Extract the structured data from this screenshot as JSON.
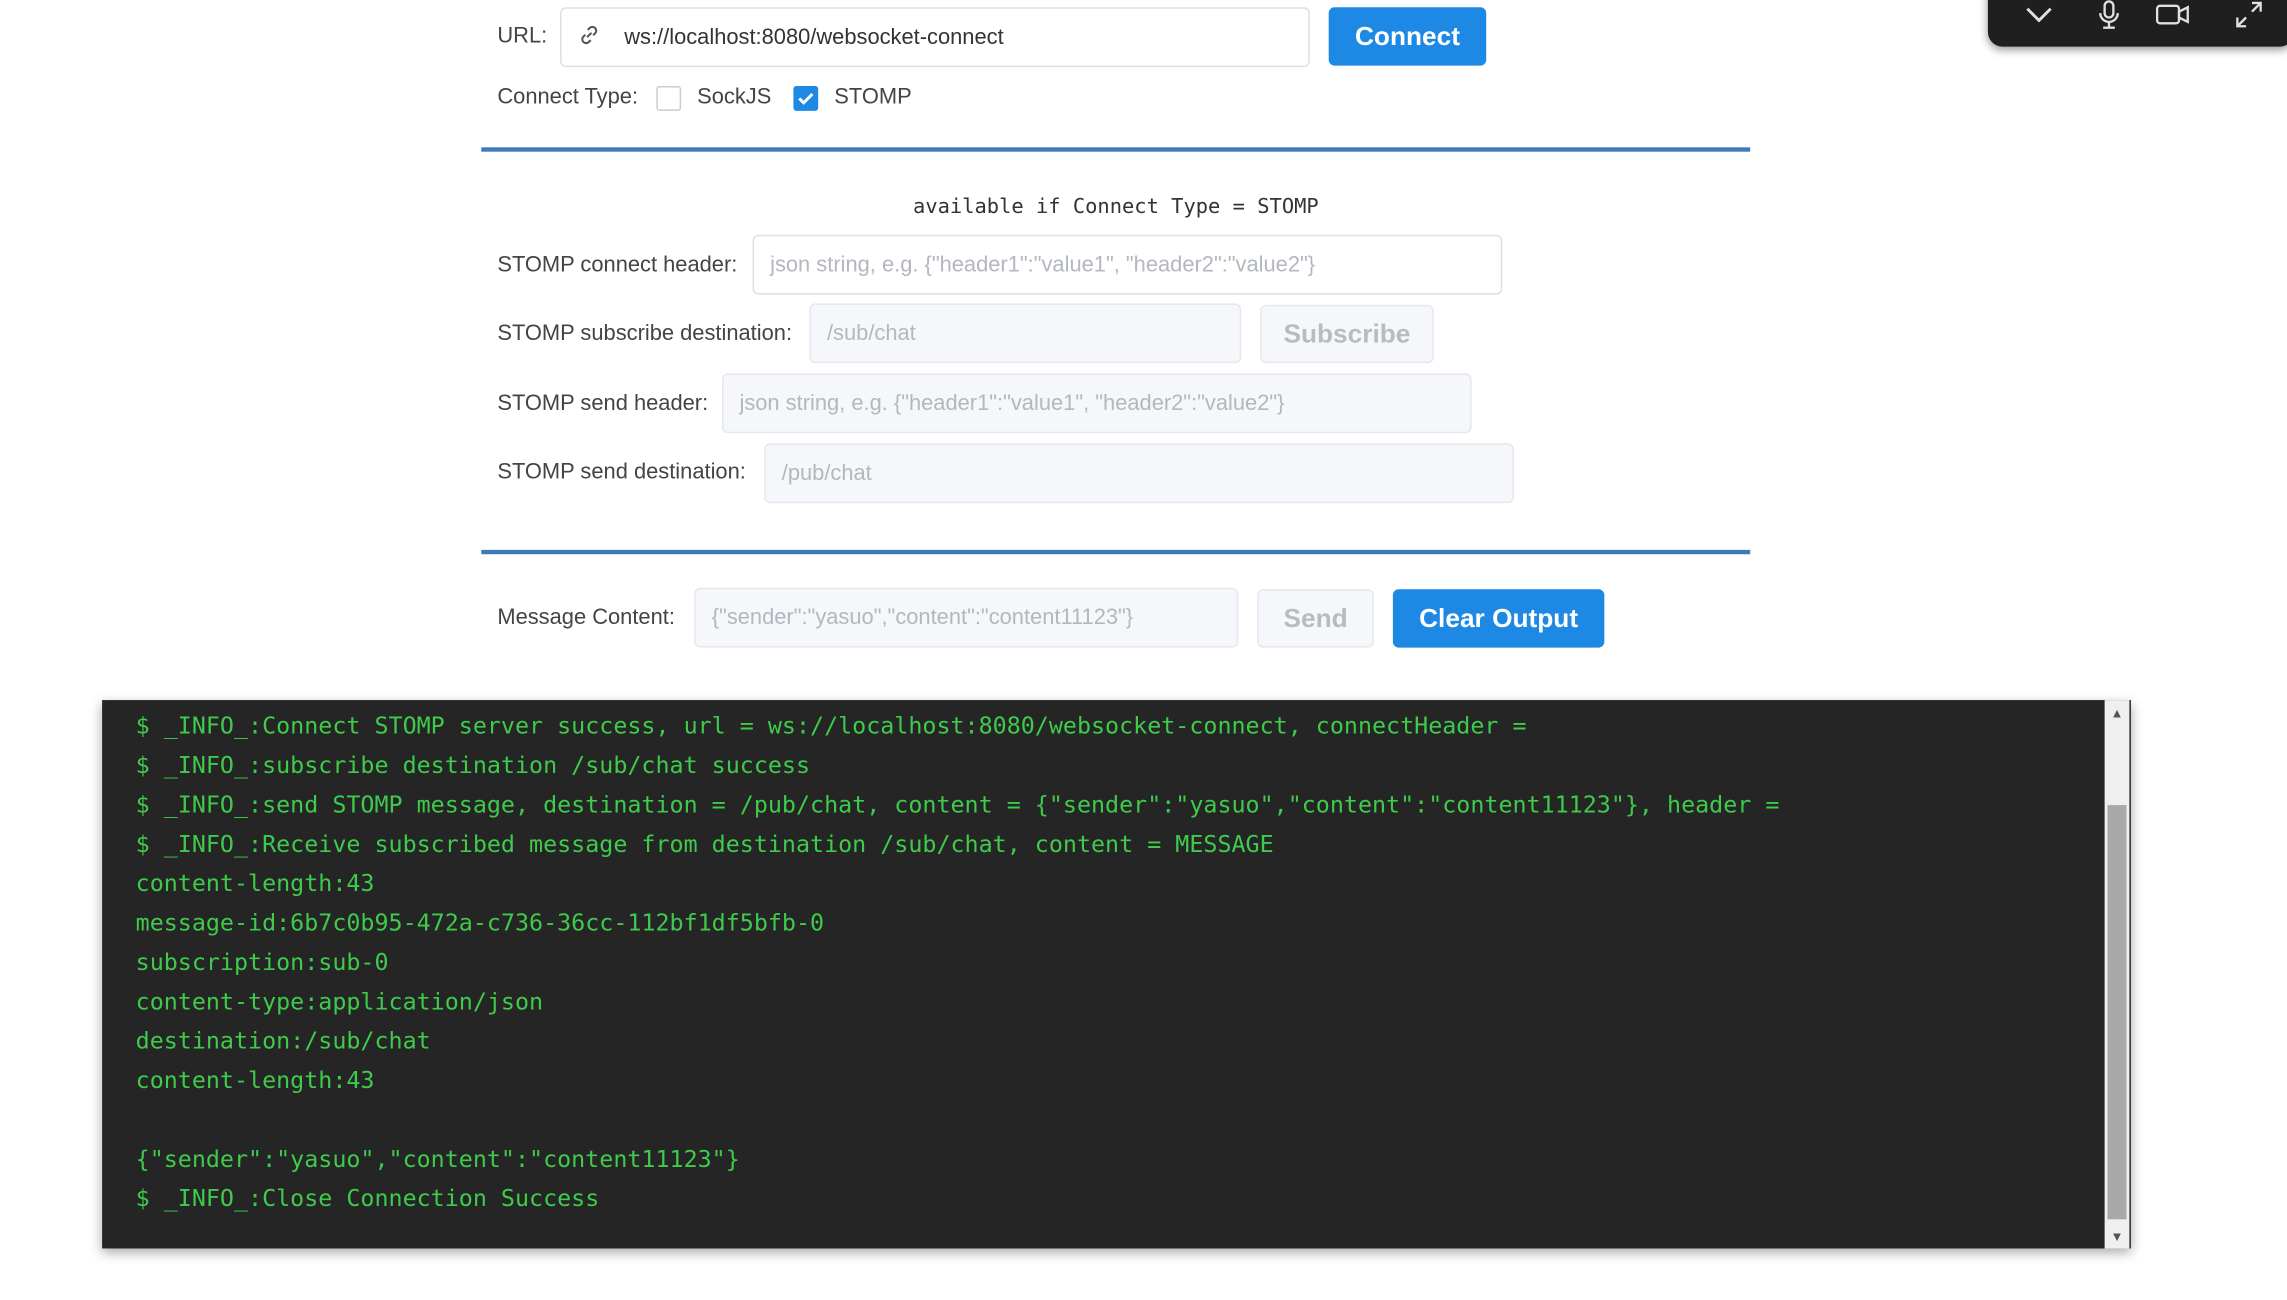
{
  "connection": {
    "url_label": "URL:",
    "url_value": "ws://localhost:8080/websocket-connect",
    "connect_label": "Connect",
    "connect_type_label": "Connect Type:",
    "types": [
      {
        "label": "SockJS",
        "checked": false
      },
      {
        "label": "STOMP",
        "checked": true
      }
    ]
  },
  "stomp": {
    "note": "available if Connect Type = STOMP",
    "connect_header_label": "STOMP connect header:",
    "connect_header_placeholder": "json string, e.g. {\"header1\":\"value1\", \"header2\":\"value2\"}",
    "subscribe_destination_label": "STOMP subscribe destination:",
    "subscribe_destination_placeholder": "/sub/chat",
    "subscribe_label": "Subscribe",
    "send_header_label": "STOMP send header:",
    "send_header_placeholder": "json string, e.g. {\"header1\":\"value1\", \"header2\":\"value2\"}",
    "send_destination_label": "STOMP send destination:",
    "send_destination_placeholder": "/pub/chat"
  },
  "message": {
    "content_label": "Message Content:",
    "content_placeholder": "{\"sender\":\"yasuo\",\"content\":\"content11123\"}",
    "send_label": "Send",
    "clear_label": "Clear Output"
  },
  "output": {
    "lines": [
      "$ _INFO_:Connect STOMP server success, url = ws://localhost:8080/websocket-connect, connectHeader =",
      "$ _INFO_:subscribe destination /sub/chat success",
      "$ _INFO_:send STOMP message, destination = /pub/chat, content = {\"sender\":\"yasuo\",\"content\":\"content11123\"}, header =",
      "$ _INFO_:Receive subscribed message from destination /sub/chat, content = MESSAGE",
      "content-length:43",
      "message-id:6b7c0b95-472a-c736-36cc-112bf1df5bfb-0",
      "subscription:sub-0",
      "content-type:application/json",
      "destination:/sub/chat",
      "content-length:43",
      "",
      "{\"sender\":\"yasuo\",\"content\":\"content11123\"}",
      "$ _INFO_:Close Connection Success"
    ]
  },
  "colors": {
    "primary": "#1e88e5",
    "divider": "#3d7ab8",
    "console_bg": "#252525",
    "console_text": "#3ecb4b"
  },
  "overlay_icons": [
    "chevron-down-icon",
    "microphone-icon",
    "camera-icon",
    "expand-icon"
  ]
}
